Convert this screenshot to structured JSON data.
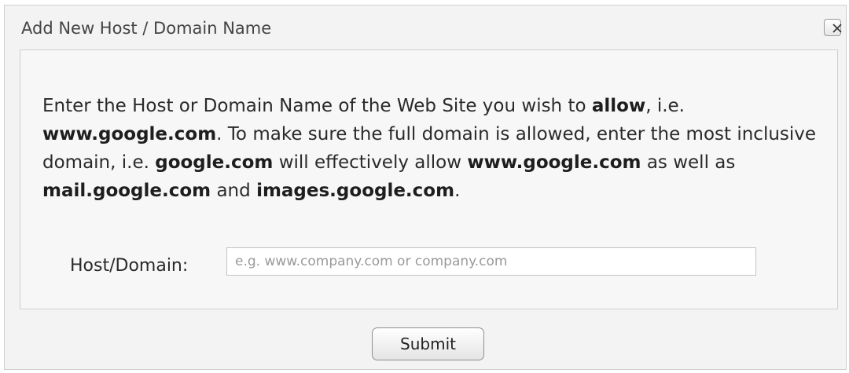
{
  "dialog": {
    "title": "Add New Host / Domain Name",
    "close_icon": "close-x-icon"
  },
  "description": {
    "parts": [
      {
        "text": "Enter the Host or Domain Name of the Web Site you wish to ",
        "bold": false
      },
      {
        "text": "allow",
        "bold": true
      },
      {
        "text": ", i.e. ",
        "bold": false
      },
      {
        "text": "www.google.com",
        "bold": true
      },
      {
        "text": ". To make sure the full domain is allowed, enter the most inclusive domain, i.e. ",
        "bold": false
      },
      {
        "text": "google.com",
        "bold": true
      },
      {
        "text": " will effectively allow ",
        "bold": false
      },
      {
        "text": "www.google.com",
        "bold": true
      },
      {
        "text": " as well as ",
        "bold": false
      },
      {
        "text": "mail.google.com",
        "bold": true
      },
      {
        "text": " and ",
        "bold": false
      },
      {
        "text": "images.google.com",
        "bold": true
      },
      {
        "text": ".",
        "bold": false
      }
    ]
  },
  "form": {
    "host_label": "Host/Domain:",
    "host_value": "",
    "host_placeholder": "e.g. www.company.com or company.com",
    "submit_label": "Submit"
  }
}
